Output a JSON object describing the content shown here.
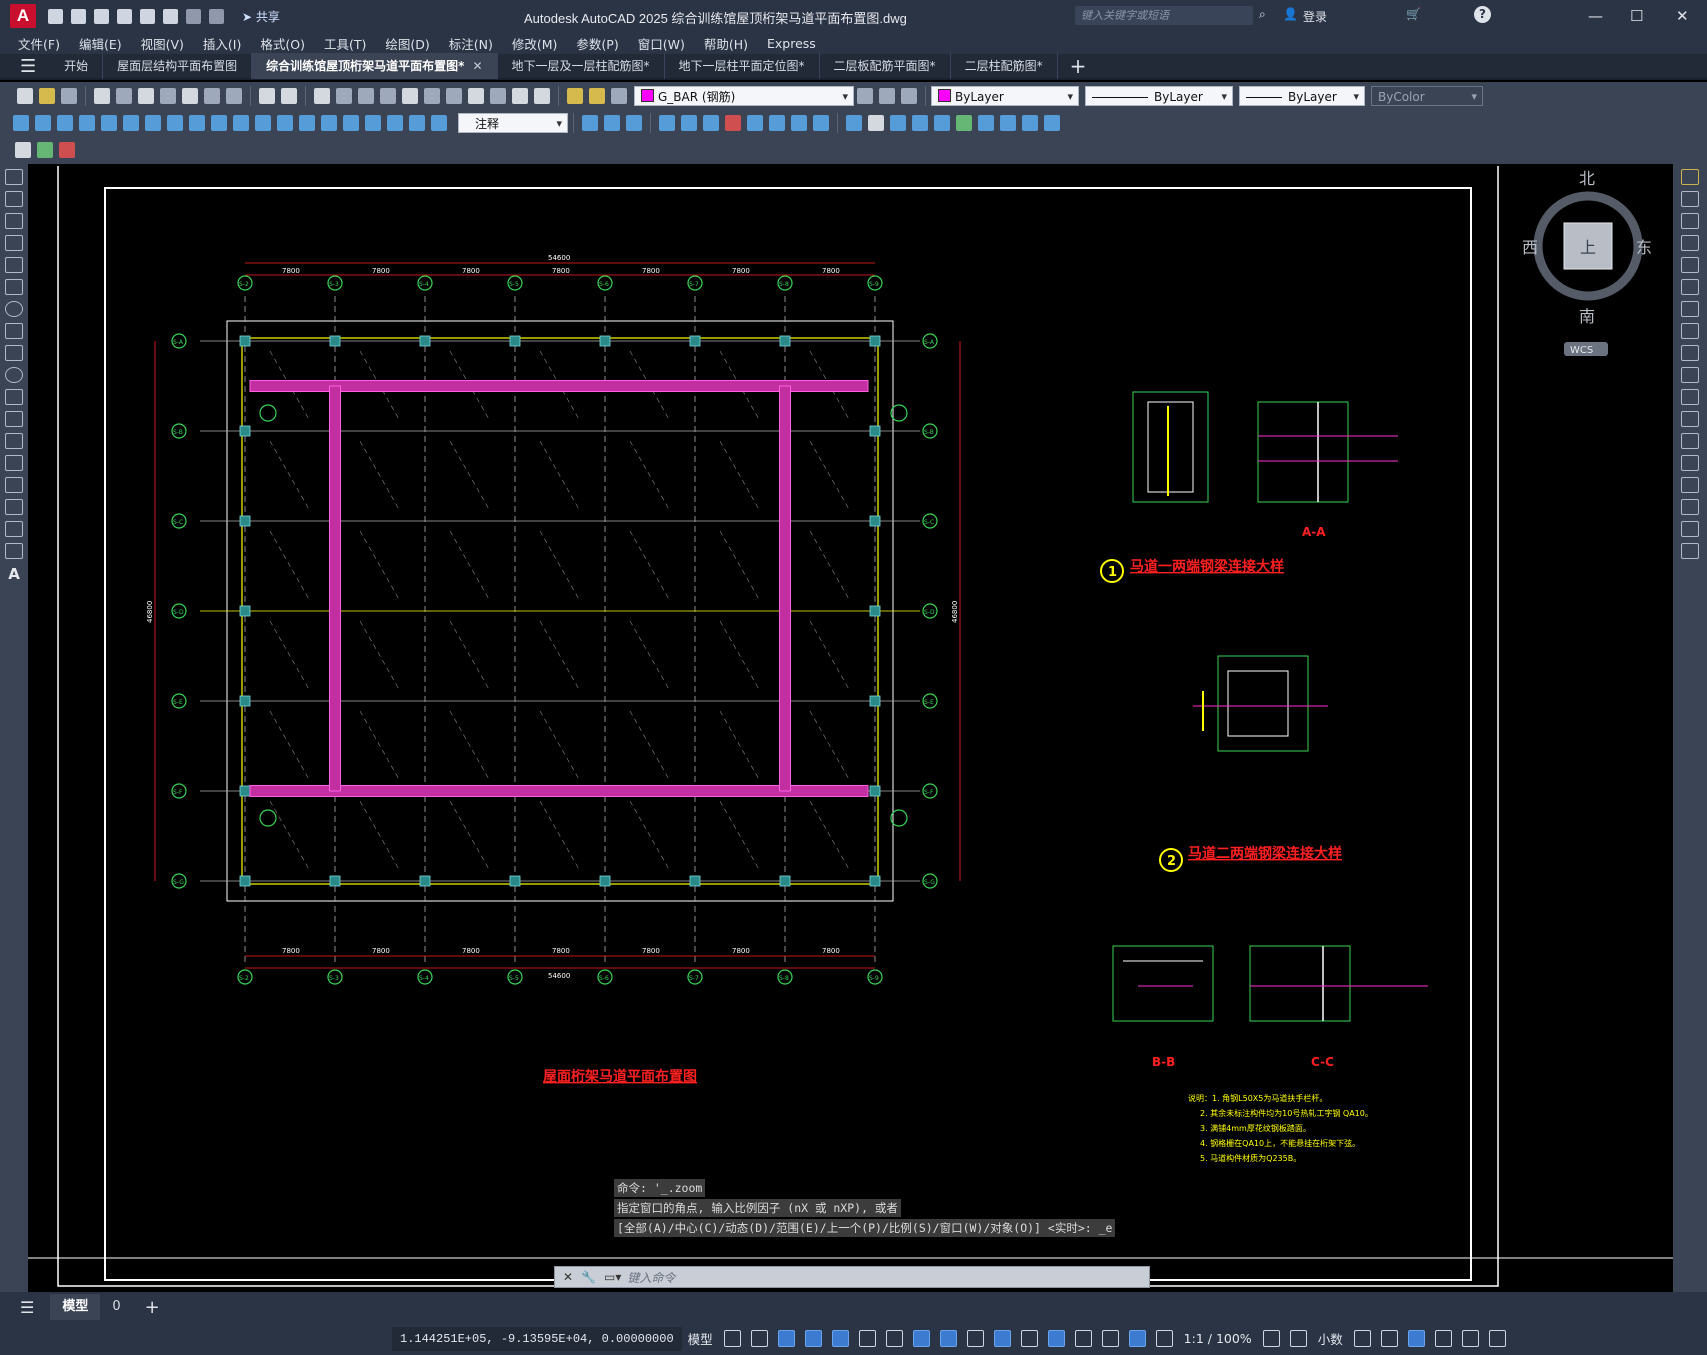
{
  "app": {
    "logo_letter": "A",
    "title": "Autodesk AutoCAD 2025    综合训练馆屋顶桁架马道平面布置图.dwg",
    "share_label": "共享",
    "search_placeholder": "键入关键字或短语",
    "login_label": "登录"
  },
  "menu": [
    "文件(F)",
    "编辑(E)",
    "视图(V)",
    "插入(I)",
    "格式(O)",
    "工具(T)",
    "绘图(D)",
    "标注(N)",
    "修改(M)",
    "参数(P)",
    "窗口(W)",
    "帮助(H)",
    "Express"
  ],
  "tabs": [
    {
      "label": "开始",
      "active": false
    },
    {
      "label": "屋面层结构平面布置图",
      "active": false
    },
    {
      "label": "综合训练馆屋顶桁架马道平面布置图*",
      "active": true
    },
    {
      "label": "地下一层及一层柱配筋图*",
      "active": false
    },
    {
      "label": "地下一层柱平面定位图*",
      "active": false
    },
    {
      "label": "二层板配筋平面图*",
      "active": false
    },
    {
      "label": "二层柱配筋图*",
      "active": false
    }
  ],
  "layer": {
    "name": "G_BAR (钢筋)",
    "color": "#ff00ff"
  },
  "properties": {
    "color": "ByLayer",
    "linetype": "ByLayer",
    "lineweight": "ByLayer",
    "plotstyle": "ByColor"
  },
  "annotation_style": "注释",
  "viewcube": {
    "north": "北",
    "south": "南",
    "east": "东",
    "west": "西",
    "top_face": "上",
    "wcs": "WCS"
  },
  "drawing": {
    "main_title": "屋面桁架马道平面布置图",
    "total_dim": "54600",
    "bay_dim": "7800",
    "side_total": "46800",
    "detail1_title": "马道一两端钢梁连接大样",
    "detail2_title": "马道二两端钢梁连接大样",
    "section_aa": "A-A",
    "section_bb": "B-B",
    "section_cc": "C-C",
    "detail_num_1": "1",
    "detail_num_2": "2",
    "grid_col_labels": [
      "S-2",
      "S-3",
      "S-4",
      "S-5",
      "S-6",
      "S-7",
      "S-8",
      "S-9"
    ],
    "grid_row_labels": [
      "S-A",
      "S-B",
      "S-C",
      "S-D",
      "S-E",
      "S-F",
      "S-G"
    ],
    "notes_heading": "说明：",
    "notes": [
      "说明：1. 角钢L50X5为马道扶手栏杆。",
      "2. 其余未标注构件均为10号热轧工字钢 QA10。",
      "3. 满铺4mm厚花纹钢板踏面。",
      "4. 钢格栅在QA10上，不能悬挂在桁架下弦。",
      "5. 马道构件材质为Q235B。"
    ]
  },
  "command": {
    "history": [
      "命令: '_.zoom",
      "指定窗口的角点, 输入比例因子 (nX 或 nXP), 或者",
      "[全部(A)/中心(C)/动态(D)/范围(E)/上一个(P)/比例(S)/窗口(W)/对象(O)] <实时>: _e"
    ],
    "placeholder": "键入命令"
  },
  "model_tabs": {
    "model": "模型",
    "layout": "0"
  },
  "status": {
    "coordinates": "1.144251E+05, -9.13595E+04, 0.00000000",
    "mode": "模型",
    "scale": "1:1 / 100%",
    "units": "小数"
  }
}
